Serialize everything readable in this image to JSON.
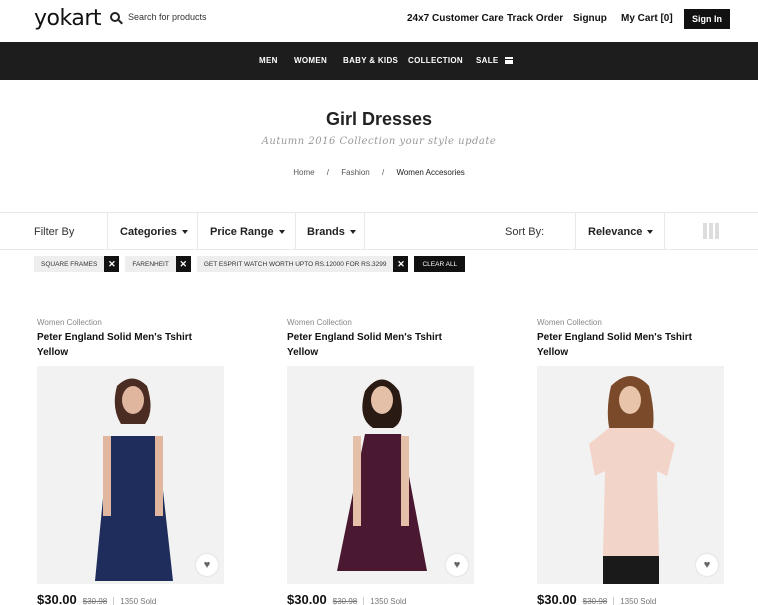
{
  "header": {
    "logo": "yokart",
    "search_placeholder": "Search for products",
    "links": [
      "24x7 Customer Care",
      "Track Order",
      "Signup",
      "My Cart [0]"
    ],
    "sign_in": "Sign In"
  },
  "nav": {
    "items": [
      "MEN",
      "WOMEN",
      "BABY & KIDS",
      "COLLECTION",
      "SALE"
    ]
  },
  "page": {
    "title": "Girl Dresses",
    "subtitle": "Autumn 2016 Collection your style update",
    "breadcrumb": [
      "Home",
      "Fashion",
      "Women Accesories"
    ],
    "breadcrumb_sep": "/"
  },
  "filters": {
    "filter_by": "Filter By",
    "categories": "Categories",
    "price_range": "Price Range",
    "brands": "Brands",
    "sort_by": "Sort By:",
    "sort_value": "Relevance"
  },
  "chips": {
    "items": [
      "SQUARE FRAMES",
      "FARENHEIT",
      "GET ESPRIT WATCH WORTH UPTO RS.12000 FOR RS.3299"
    ],
    "remove": "✕",
    "clear_all": "CLEAR ALL"
  },
  "products": [
    {
      "category": "Women Collection",
      "name": "Peter England Solid Men's Tshirt Yellow",
      "price": "$30.00",
      "old_price": "$30.98",
      "sold": "1350 Sold",
      "dress_color": "#1f2d5c"
    },
    {
      "category": "Women Collection",
      "name": "Peter England Solid Men's Tshirt Yellow",
      "price": "$30.00",
      "old_price": "$30.98",
      "sold": "1350 Sold",
      "dress_color": "#4a1830"
    },
    {
      "category": "Women Collection",
      "name": "Peter England Solid Men's Tshirt Yellow",
      "price": "$30.00",
      "old_price": "$30.98",
      "sold": "1350 Sold",
      "dress_color": "#f3d4c8"
    }
  ],
  "icons": {
    "heart": "♥"
  }
}
